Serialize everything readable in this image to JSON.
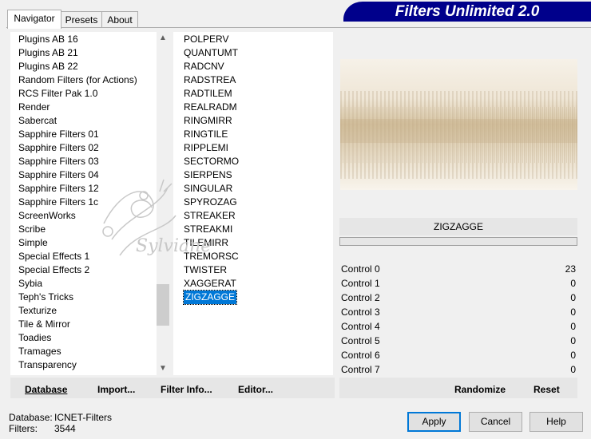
{
  "tabs": [
    "Navigator",
    "Presets",
    "About"
  ],
  "banner_title": "Filters Unlimited 2.0",
  "categories": [
    "Plugins AB 16",
    "Plugins AB 21",
    "Plugins AB 22",
    "Random Filters (for Actions)",
    "RCS Filter Pak 1.0",
    "Render",
    "Sabercat",
    "Sapphire Filters 01",
    "Sapphire Filters 02",
    "Sapphire Filters 03",
    "Sapphire Filters 04",
    "Sapphire Filters 12",
    "Sapphire Filters 1c",
    "ScreenWorks",
    "Scribe",
    "Simple",
    "Special Effects 1",
    "Special Effects 2",
    "Sybia",
    "Teph's Tricks",
    "Texturize",
    "Tile & Mirror",
    "Toadies",
    "Tramages",
    "Transparency"
  ],
  "filters": [
    "POLPERV",
    "QUANTUMT",
    "RADCNV",
    "RADSTREA",
    "RADTILEM",
    "REALRADM",
    "RINGMIRR",
    "RINGTILE",
    "RIPPLEMI",
    "SECTORMO",
    "SIERPENS",
    "SINGULAR",
    "SPYROZAG",
    "STREAKER",
    "STREAKMI",
    "TILEMIRR",
    "TREMORSC",
    "TWISTER",
    "XAGGERAT",
    "ZIGZAGGE"
  ],
  "selected_filter": "ZIGZAGGE",
  "filter_name_display": "ZIGZAGGE",
  "watermark_text": "Sylviane",
  "controls": [
    {
      "label": "Control 0",
      "value": "23"
    },
    {
      "label": "Control 1",
      "value": "0"
    },
    {
      "label": "Control 2",
      "value": "0"
    },
    {
      "label": "Control 3",
      "value": "0"
    },
    {
      "label": "Control 4",
      "value": "0"
    },
    {
      "label": "Control 5",
      "value": "0"
    },
    {
      "label": "Control 6",
      "value": "0"
    },
    {
      "label": "Control 7",
      "value": "0"
    }
  ],
  "bottom_buttons": {
    "database": "Database",
    "import": "Import...",
    "filter_info": "Filter Info...",
    "editor": "Editor...",
    "randomize": "Randomize",
    "reset": "Reset"
  },
  "status": {
    "db_label": "Database:",
    "db_value": "ICNET-Filters",
    "filters_label": "Filters:",
    "filters_value": "3544"
  },
  "dialog_buttons": {
    "apply": "Apply",
    "cancel": "Cancel",
    "help": "Help"
  },
  "icons": {
    "scroll_up": "chevron-up-icon",
    "scroll_down": "chevron-down-icon"
  },
  "colors": {
    "banner": "#00008b",
    "selection": "#0078d7"
  }
}
